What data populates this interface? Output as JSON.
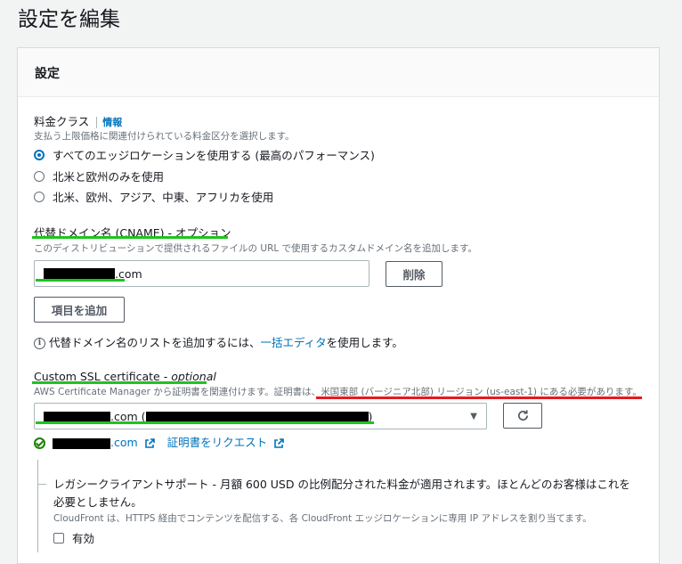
{
  "page": {
    "title": "設定を編集"
  },
  "panel": {
    "title": "設定"
  },
  "price_class": {
    "label": "料金クラス",
    "info": "情報",
    "description": "支払う上限価格に関連付けられている料金区分を選択します。",
    "options": [
      {
        "label": "すべてのエッジロケーションを使用する (最高のパフォーマンス)",
        "selected": true
      },
      {
        "label": "北米と欧州のみを使用",
        "selected": false
      },
      {
        "label": "北米、欧州、アジア、中東、アフリカを使用",
        "selected": false
      }
    ]
  },
  "cname": {
    "label": "代替ドメイン名 (CNAME) - オプション",
    "description": "このディストリビューションで提供されるファイルの URL で使用するカスタムドメイン名を追加します。",
    "value_suffix": ".com",
    "remove_button": "削除",
    "add_item_button": "項目を追加",
    "bulk_prefix": "代替ドメイン名のリストを追加するには、",
    "bulk_link": "一括エディタ",
    "bulk_suffix": "を使用します。"
  },
  "ssl": {
    "label_plain": "Custom SSL certificate - ",
    "label_italic": "optional",
    "description_prefix": "AWS Certificate Manager から証明書を関連付けます。証明書は、",
    "description_highlight": "米国東部 (バージニア北部) リージョン (us-east-1) にある必要があります。",
    "select_value_mid": ".com (",
    "select_value_end": ")",
    "cert_link_suffix": ".com",
    "request_link": "証明書をリクエスト"
  },
  "legacy": {
    "title": "レガシークライアントサポート - 月額 600 USD の比例配分された料金が適用されます。ほとんどのお客様はこれを必要としません。",
    "description": "CloudFront は、HTTPS 経由でコンテンツを配信する、各 CloudFront エッジロケーションに専用 IP アドレスを割り当てます。",
    "checkbox_label": "有効"
  },
  "colors": {
    "link": "#0073bb",
    "annotation_green": "#1ec41e",
    "annotation_red": "#e8191e",
    "success": "#1d8102"
  }
}
